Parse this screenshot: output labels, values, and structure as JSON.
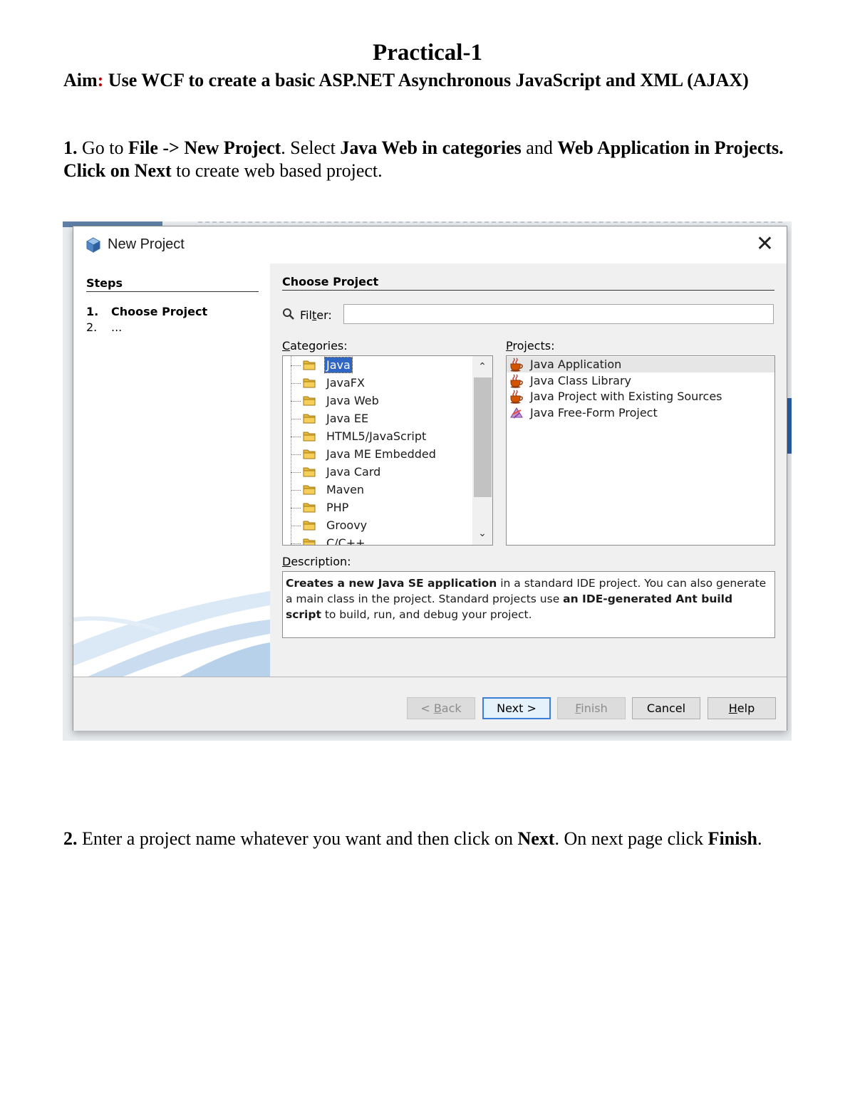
{
  "doc": {
    "title": "Practical-1",
    "aim_label": "Aim",
    "aim_colon": ":",
    "aim_text": " Use WCF to create a basic ASP.NET Asynchronous JavaScript and XML (AJAX)",
    "step1": {
      "num": "1.",
      "t1": " Go to ",
      "b1": "File -> New Project",
      "t2": ". Select ",
      "b2": "Java Web in categories",
      "t3": " and ",
      "b3": "Web Application in Projects. Click on Next",
      "t4": " to create web based project."
    },
    "step2": {
      "num": "2.",
      "t1": " Enter a project name whatever you want and then click on ",
      "b1": "Next",
      "t2": ". On next page click ",
      "b2": "Finish",
      "t3": "."
    }
  },
  "dialog": {
    "title": "New Project",
    "close_symbol": "✕",
    "steps_header": "Steps",
    "steps": [
      {
        "num": "1.",
        "label": "Choose Project"
      },
      {
        "num": "2.",
        "label": "..."
      }
    ],
    "panel_title": "Choose Project",
    "filter_label_pre": "Fil",
    "filter_label_u": "t",
    "filter_label_post": "er:",
    "filter_value": "",
    "categories_label_u": "C",
    "categories_label_rest": "ategories:",
    "categories": [
      "Java",
      "JavaFX",
      "Java Web",
      "Java EE",
      "HTML5/JavaScript",
      "Java ME Embedded",
      "Java Card",
      "Maven",
      "PHP",
      "Groovy",
      "C/C++"
    ],
    "selected_category": "Java",
    "projects_label_u": "P",
    "projects_label_rest": "rojects:",
    "projects": [
      {
        "label": "Java Application",
        "icon": "coffee-cup-icon"
      },
      {
        "label": "Java Class Library",
        "icon": "coffee-cup-icon"
      },
      {
        "label": "Java Project with Existing Sources",
        "icon": "coffee-cup-icon"
      },
      {
        "label": "Java Free-Form Project",
        "icon": "free-form-project-icon"
      }
    ],
    "selected_project": "Java Application",
    "description_label_u": "D",
    "description_label_rest": "escription:",
    "description": {
      "b1": "Creates a new Java SE application",
      "t1": " in a standard IDE project. You can also generate a main class in the project. Standard projects use ",
      "b2": "an IDE-generated Ant build script",
      "t2": " to build, run, and debug your project."
    },
    "buttons": {
      "back_pre": "< ",
      "back_u": "B",
      "back_post": "ack",
      "next": "Next >",
      "finish_u": "F",
      "finish_post": "inish",
      "cancel": "Cancel",
      "help_u": "H",
      "help_post": "elp"
    },
    "colors": {
      "selection": "#2f65c4",
      "default_button_border": "#3c7fd8",
      "aim_colon": "#c00000"
    }
  }
}
